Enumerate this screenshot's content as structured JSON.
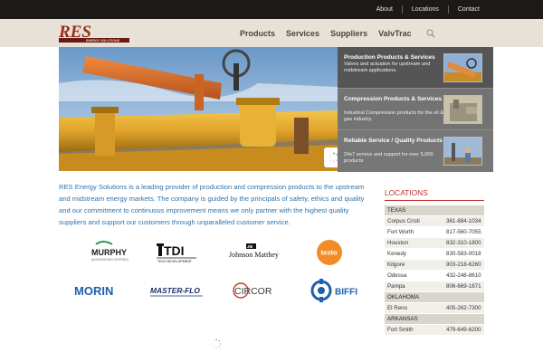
{
  "topbar": {
    "links": [
      {
        "label": "About"
      },
      {
        "label": "Locations"
      },
      {
        "label": "Contact"
      }
    ]
  },
  "header": {
    "logo_text": "RES",
    "logo_subtext": "ENERGY SOLUTIONS",
    "nav": [
      {
        "label": "Products"
      },
      {
        "label": "Services"
      },
      {
        "label": "Suppliers"
      },
      {
        "label": "ValvTrac"
      }
    ],
    "search_icon": "magnifier-icon"
  },
  "slides": [
    {
      "title": "Production Products & Services",
      "desc": "Valves and actuation for upstream and midstream applications."
    },
    {
      "title": "Compression Products & Services",
      "desc": "Industrial Compression products for the oil & gas industry."
    },
    {
      "title": "Reliable Service / Quality Products",
      "desc": "24x7 service and support for over 5,000 products"
    }
  ],
  "intro": "RES Energy Solutions is a leading provider of production and compression products to the upstream and midstream energy markets. The company is guided by the principals of safety, ethics and quality and our commitment to continuous improvement means we only partner with the highest quality suppliers and support our customers through unparalleled customer service.",
  "brands": [
    {
      "name": "MURPHY",
      "sub": "by ENOVATION CONTROLS"
    },
    {
      "name": "TDI",
      "sub": "TECH DEVELOPMENT"
    },
    {
      "name": "Johnson Matthey",
      "sub": "JM"
    },
    {
      "name": "testo",
      "sub": ""
    },
    {
      "name": "MORIN",
      "sub": ""
    },
    {
      "name": "MASTER-FLO",
      "sub": ""
    },
    {
      "name": "CIRCOR",
      "sub": ""
    },
    {
      "name": "BIFFI",
      "sub": ""
    }
  ],
  "locations": {
    "title": "LOCATIONS",
    "groups": [
      {
        "state": "TEXAS",
        "rows": [
          {
            "city": "Corpus Cristi",
            "phone": "361-884-1034"
          },
          {
            "city": "Fort Worth",
            "phone": "817-560-7055"
          },
          {
            "city": "Houston",
            "phone": "832-310-1800"
          },
          {
            "city": "Kenedy",
            "phone": "830-583-0018"
          },
          {
            "city": "Kilgore",
            "phone": "903-218-6260"
          },
          {
            "city": "Odessa",
            "phone": "432-248-8610"
          },
          {
            "city": "Pampa",
            "phone": "806-669-1871"
          }
        ]
      },
      {
        "state": "OKLAHOMA",
        "rows": [
          {
            "city": "El Reno",
            "phone": "405-262-7300"
          }
        ]
      },
      {
        "state": "ARKANSAS",
        "rows": [
          {
            "city": "Fort Smith",
            "phone": "479-649-6200"
          }
        ]
      }
    ]
  },
  "colors": {
    "brand_red": "#c0302c",
    "link_blue": "#2f73ad",
    "topbar": "#1b1a18",
    "header": "#e7e1d7"
  }
}
